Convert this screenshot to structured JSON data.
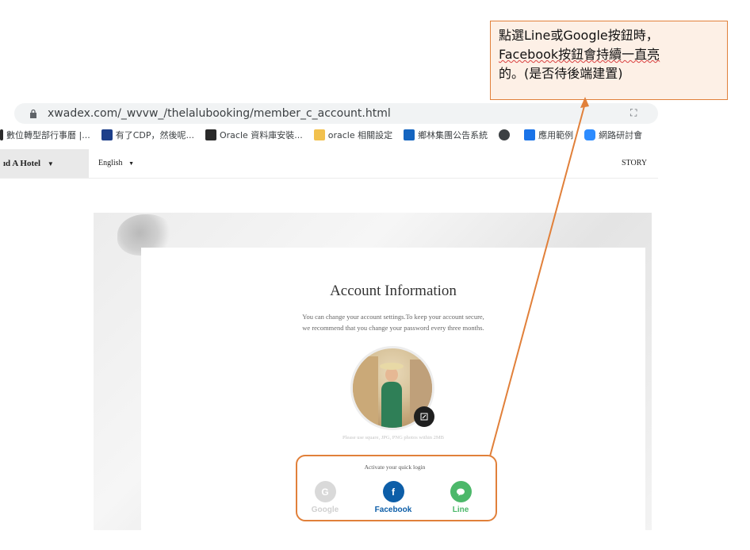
{
  "browser": {
    "url": "xwadex.com/_wvvw_/thelalubooking/member_c_account.html",
    "bookmarks": [
      {
        "label": "數位轉型部行事曆 |...",
        "icon": "bookmark-icon",
        "color": "#2b2b2b"
      },
      {
        "label": "有了CDP，然後呢...",
        "icon": "set-logo-icon",
        "color": "#1d3f8a"
      },
      {
        "label": "Oracle 資料庫安裝...",
        "icon": "oracle-logo-icon",
        "color": "#2a2a2a"
      },
      {
        "label": "oracle 相關設定",
        "icon": "folder-icon",
        "color": "#f2c14e"
      },
      {
        "label": "鄉林集團公告系統",
        "icon": "flag-icon",
        "color": "#1565c0"
      },
      {
        "label": "",
        "icon": "globe-icon",
        "color": "#3c4043"
      },
      {
        "label": "應用範例",
        "icon": "v-logo-icon",
        "color": "#1a73e8"
      },
      {
        "label": "網路研討會",
        "icon": "zoom-icon",
        "color": "#2d8cff"
      }
    ]
  },
  "nav": {
    "hotel": "ıd A Hotel",
    "language": "English",
    "story": "STORY"
  },
  "account": {
    "title": "Account Information",
    "subtitle_line1": "You can change your account settings.To keep your account secure,",
    "subtitle_line2": "we recommend that you change your password every three months.",
    "photo_hint": "Please use square, JPG, PNG photos within 2MB",
    "quick_login_title": "Activate your quick login",
    "social": [
      {
        "label": "Google",
        "letter": "G",
        "color": "#d9d9d9",
        "text_color": "#d0d0d0",
        "icon": "google-icon"
      },
      {
        "label": "Facebook",
        "letter": "f",
        "color": "#0d5ea8",
        "text_color": "#0d5ea8",
        "icon": "facebook-icon"
      },
      {
        "label": "Line",
        "letter": "…",
        "color": "#4cb86a",
        "text_color": "#4cb86a",
        "icon": "line-icon"
      }
    ]
  },
  "annotation": {
    "line1": "點選Line或Google按鈕時，",
    "line2": "Facebook按鈕會持續一直亮",
    "line3": "的。(是否待後端建置)",
    "color": "#e1803a"
  }
}
